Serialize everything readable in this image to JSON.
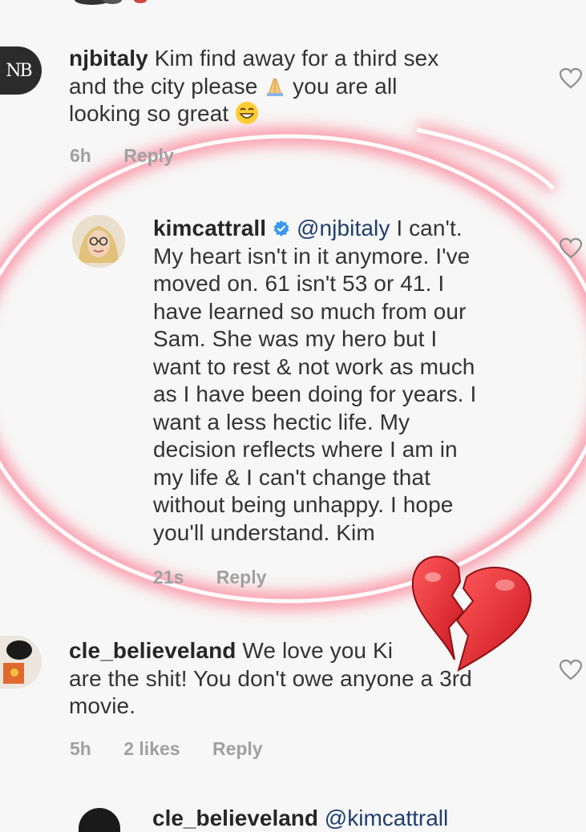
{
  "comments": [
    {
      "username": "njbitaly",
      "avatar_text": "NB",
      "lines": [
        "Kim find away for a third sex",
        "and the city please",
        "you are all",
        "looking so great"
      ],
      "time": "6h",
      "reply": "Reply"
    },
    {
      "username": "kimcattrall",
      "mention": "@njbitaly",
      "lines": [
        "I can't.",
        "My heart isn't in it anymore. I've",
        "moved on. 61 isn't 53 or 41. I",
        "have learned so much from our",
        "Sam. She was my hero but I",
        "want to rest & not work as much",
        "as I have been doing for years. I",
        "want a less hectic life. My",
        "decision reflects where I am in",
        "my life & I can't change that",
        "without being unhappy. I hope",
        "you'll understand. Kim"
      ],
      "time": "21s",
      "reply": "Reply"
    },
    {
      "username": "cle_believeland",
      "lines": [
        "We love you Ki",
        "are the shit! You don't owe anyone a 3rd",
        "movie."
      ],
      "time": "5h",
      "likes": "2 likes",
      "reply": "Reply"
    }
  ],
  "partial_bottom": {
    "username": "cle_believeland",
    "mention": "@kimcattrall"
  },
  "colors": {
    "highlight_ring": "#ff5a6e",
    "broken_heart": "#e5202e",
    "verified_badge": "#3897f0",
    "meta_text": "#a0a0a0"
  },
  "icons": [
    "heart-outline-icon",
    "verified-badge-icon",
    "folded-hands-emoji",
    "grinning-emoji",
    "broken-heart-emoji"
  ]
}
